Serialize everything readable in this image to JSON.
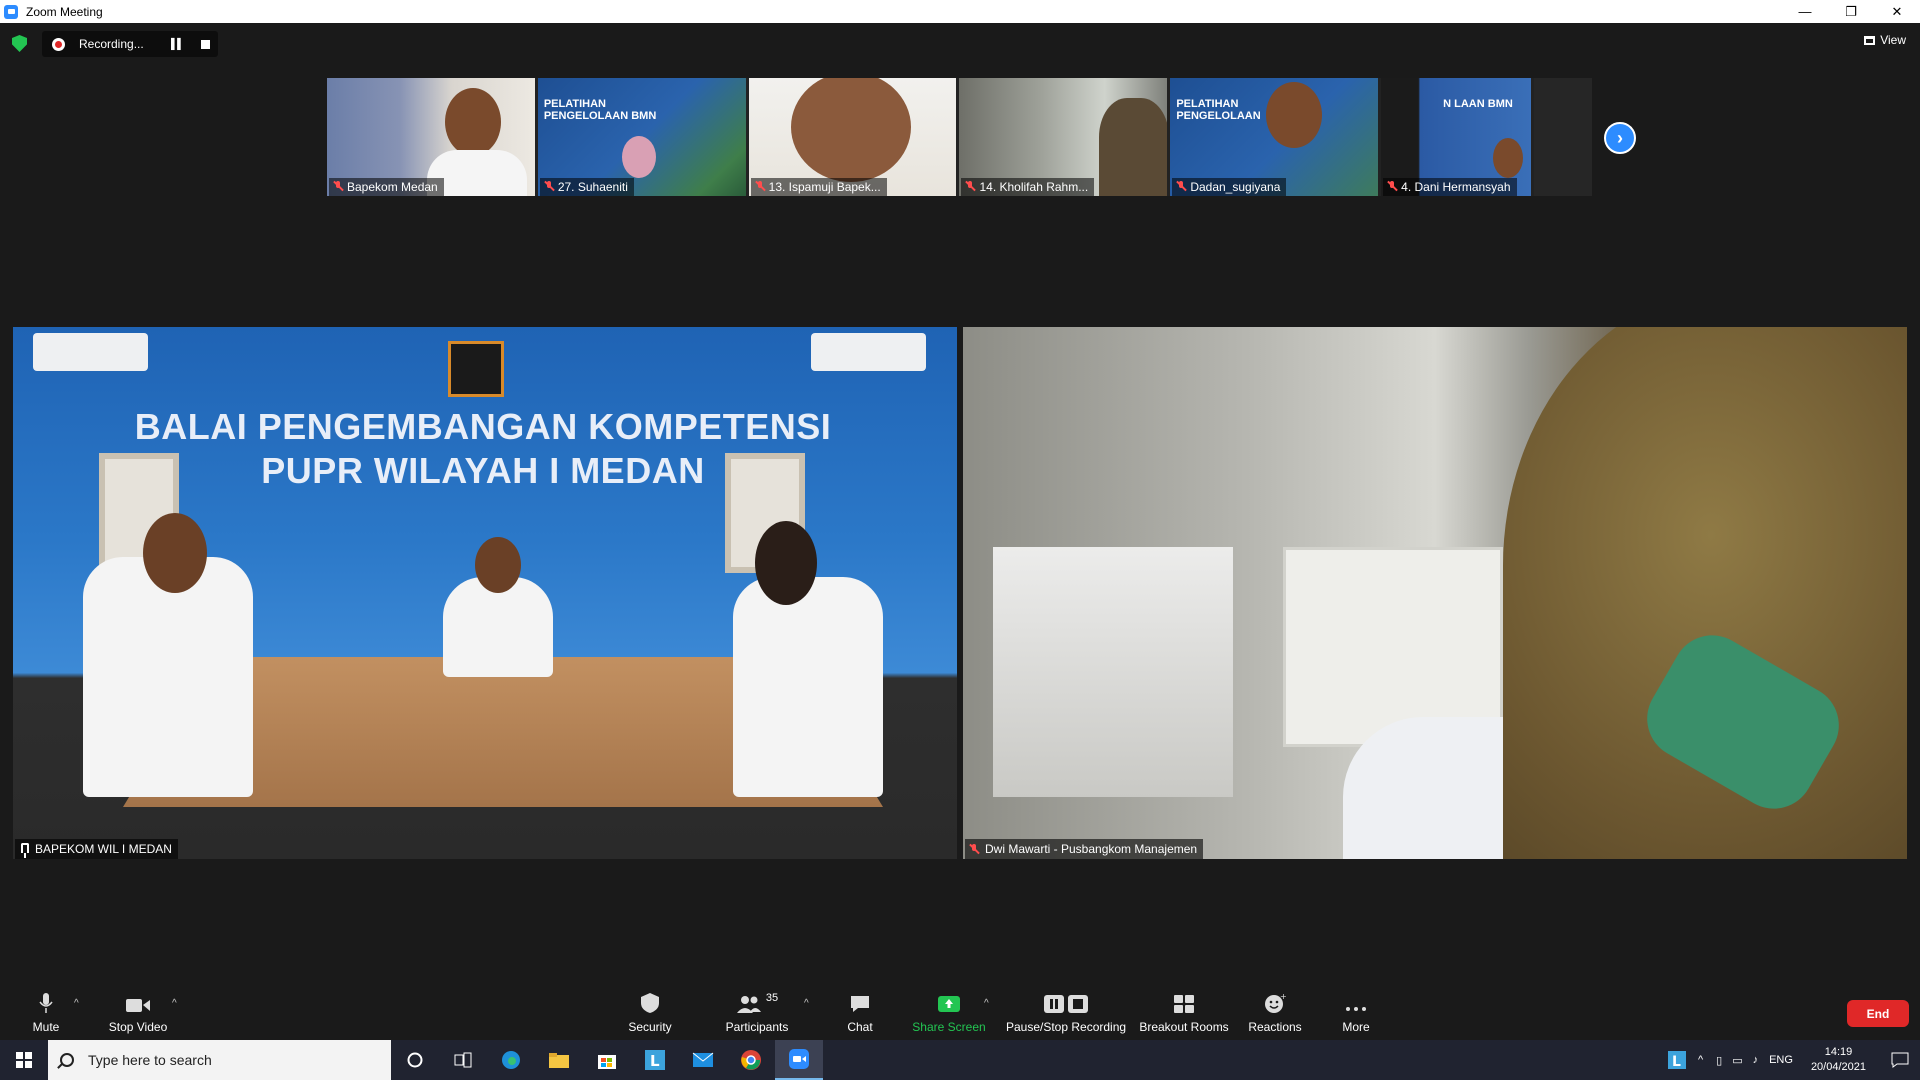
{
  "window": {
    "title": "Zoom Meeting",
    "minimize": "—",
    "restore": "❐",
    "close": "✕"
  },
  "recording": {
    "status": "Recording...",
    "pause_icon": "pause-icon",
    "stop_icon": "stop-icon"
  },
  "view": {
    "label": "View"
  },
  "thumbnails": [
    {
      "name": "Bapekom Medan"
    },
    {
      "name": "27. Suhaeniti",
      "banner": "PELATIHAN PENGELOLAAN BMN"
    },
    {
      "name": "13. Ispamuji Bapek..."
    },
    {
      "name": "14. Kholifah Rahm..."
    },
    {
      "name": "Dadan_sugiyana",
      "banner": "PELATIHAN PENGELOLAAN"
    },
    {
      "name": "4. Dani Hermansyah",
      "banner": "N LAAN BMN"
    }
  ],
  "main_videos": {
    "left": {
      "name": "BAPEKOM WIL I MEDAN",
      "banner_line1": "BALAI PENGEMBANGAN KOMPETENSI",
      "banner_line2": "PUPR WILAYAH I MEDAN"
    },
    "right": {
      "name": "Dwi Mawarti - Pusbangkom Manajemen"
    }
  },
  "toolbar": {
    "mute": "Mute",
    "stop_video": "Stop Video",
    "security": "Security",
    "participants": "Participants",
    "participants_count": "35",
    "chat": "Chat",
    "share_screen": "Share Screen",
    "pause_stop_recording": "Pause/Stop Recording",
    "breakout_rooms": "Breakout Rooms",
    "reactions": "Reactions",
    "more": "More",
    "end": "End"
  },
  "taskbar": {
    "search_placeholder": "Type here to search",
    "language": "ENG",
    "time": "14:19",
    "date": "20/04/2021"
  },
  "colors": {
    "accent": "#2d8cff",
    "share_green": "#23c552",
    "end_red": "#e02828",
    "muted_red": "#ff4d4d"
  }
}
